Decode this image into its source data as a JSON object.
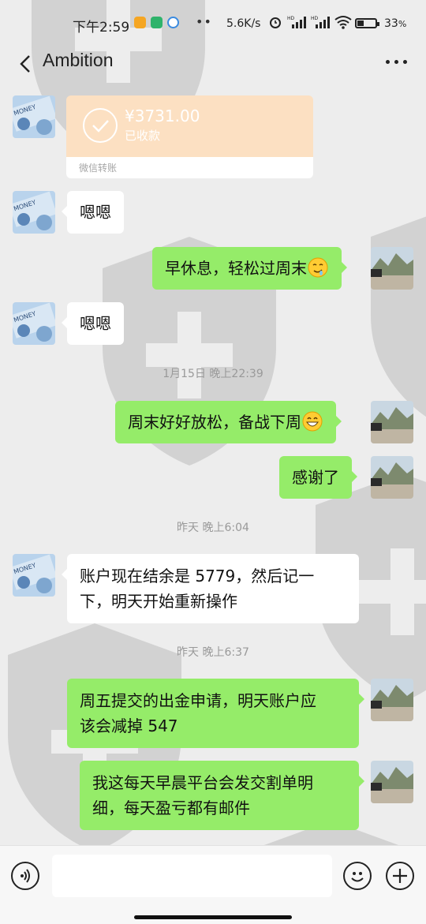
{
  "status_bar": {
    "time": "下午2:59",
    "speed": "5.6K/s",
    "battery": "33",
    "battery_unit": "%",
    "dots": "••",
    "icons": [
      "notification-icon",
      "shield-app-icon",
      "weibo-icon",
      "alarm-icon",
      "hd-signal-icon",
      "hd-signal-icon",
      "wifi-icon",
      "battery-icon"
    ]
  },
  "header": {
    "title": "Ambition",
    "back_icon": "chevron-left-icon",
    "more_icon": "more-dots-icon"
  },
  "transfer": {
    "amount": "¥3731.00",
    "status": "已收款",
    "label": "微信转账"
  },
  "messages": [
    {
      "side": "left",
      "text": "嗯嗯"
    },
    {
      "side": "right",
      "text": "早休息，轻松过周末",
      "emoji": "drooling-face"
    },
    {
      "side": "left",
      "text": "嗯嗯"
    },
    {
      "side": "right",
      "text": "周末好好放松，备战下周",
      "emoji": "grinning-face"
    },
    {
      "side": "right",
      "text": "感谢了"
    },
    {
      "side": "left",
      "text_lines": [
        "账户现在结余是 5779，然后记一",
        "下，明天开始重新操作"
      ]
    },
    {
      "side": "right",
      "text_lines": [
        "周五提交的出金申请，明天账户应",
        "该会减掉 547"
      ]
    },
    {
      "side": "right",
      "text_lines": [
        "我这每天早晨平台会发交割单明",
        "细，每天盈亏都有邮件"
      ]
    }
  ],
  "timestamps": [
    "1月15日 晚上22:39",
    "昨天 晚上6:04",
    "昨天 晚上6:37"
  ],
  "input_bar": {
    "voice_icon": "voice-icon",
    "emoji_icon": "emoji-icon",
    "plus_icon": "plus-icon",
    "input_value": ""
  },
  "colors": {
    "background": "#ededed",
    "bubble_out": "#95ec69",
    "bubble_in": "#ffffff",
    "transfer_card": "#fce0c2"
  }
}
